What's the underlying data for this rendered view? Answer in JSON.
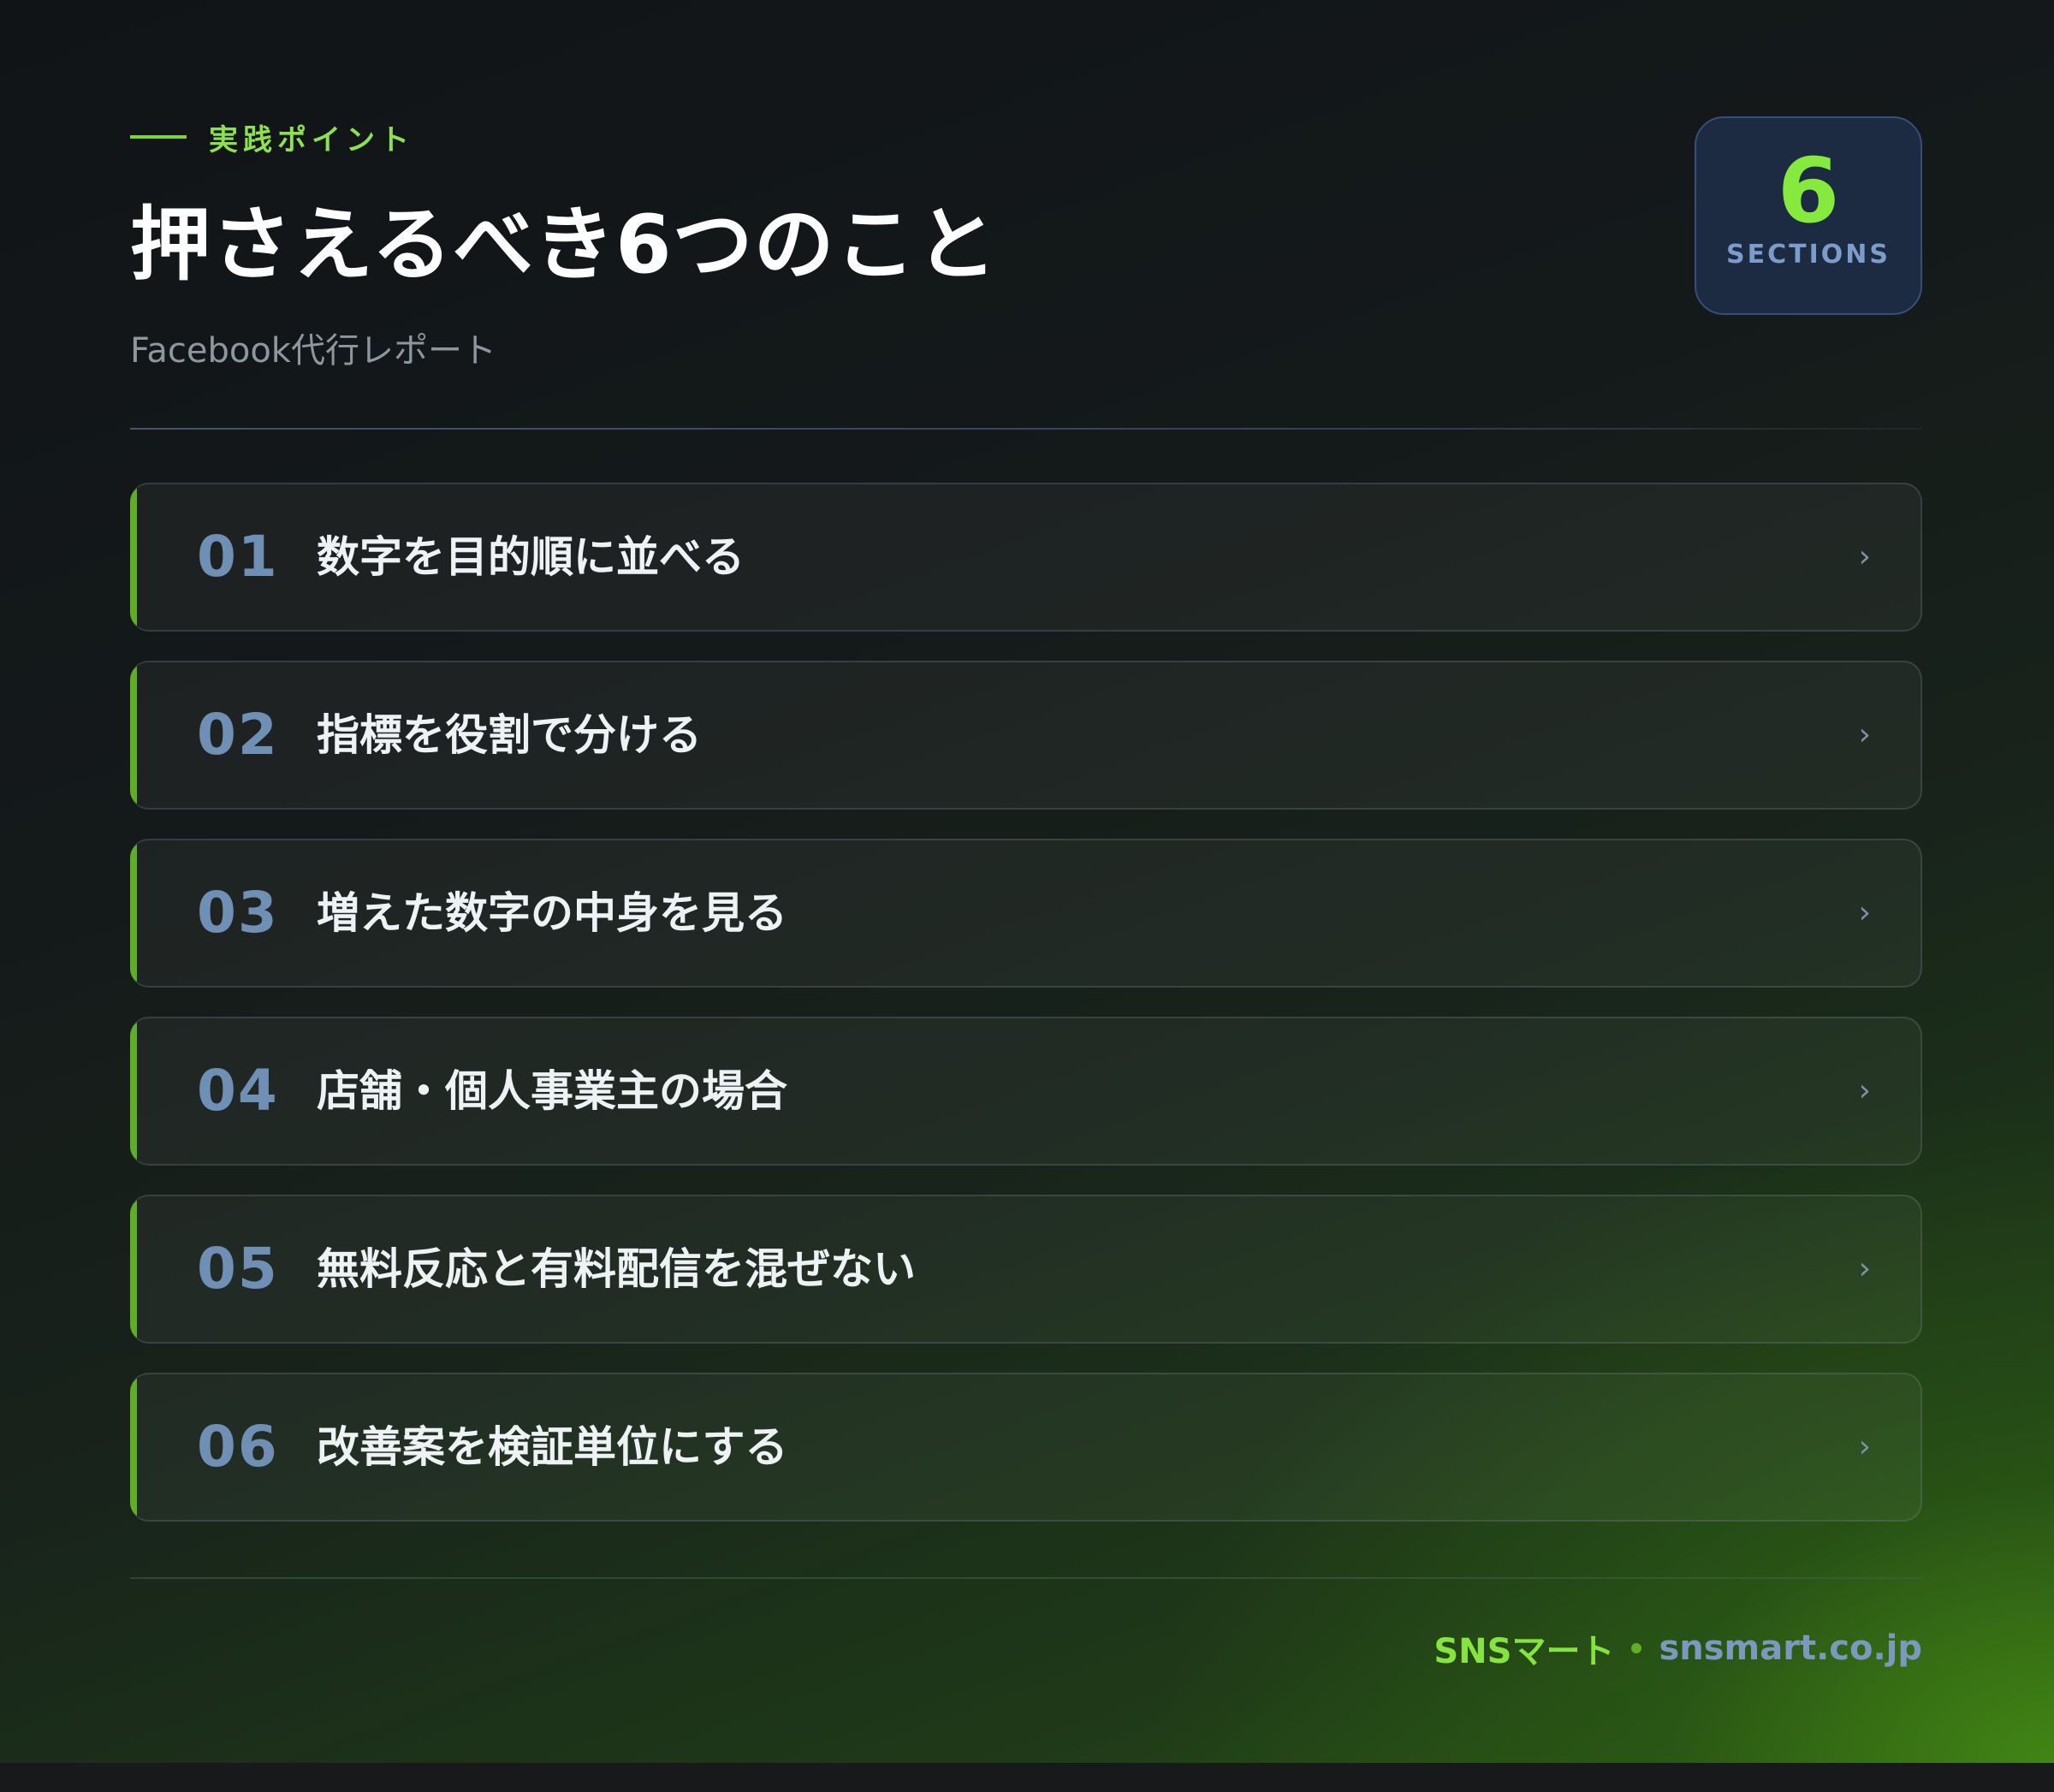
{
  "header": {
    "eyebrow": "実践ポイント",
    "title": "押さえるべき6つのこと",
    "subtitle": "Facebook代行レポート"
  },
  "badge": {
    "number": "6",
    "label": "SECTIONS"
  },
  "items": [
    {
      "number": "01",
      "text": "数字を目的順に並べる",
      "chevron": "›"
    },
    {
      "number": "02",
      "text": "指標を役割で分ける",
      "chevron": "›"
    },
    {
      "number": "03",
      "text": "増えた数字の中身を見る",
      "chevron": "›"
    },
    {
      "number": "04",
      "text": "店舗・個人事業主の場合",
      "chevron": "›"
    },
    {
      "number": "05",
      "text": "無料反応と有料配信を混ぜない",
      "chevron": "›"
    },
    {
      "number": "06",
      "text": "改善案を検証単位にする",
      "chevron": "›"
    }
  ],
  "footer": {
    "brand": "SNSマート",
    "url": "snsmart.co.jp"
  },
  "colors": {
    "accent": "#86e440",
    "number": "#6f8fb5",
    "badge_bg": "#1c2a42"
  }
}
